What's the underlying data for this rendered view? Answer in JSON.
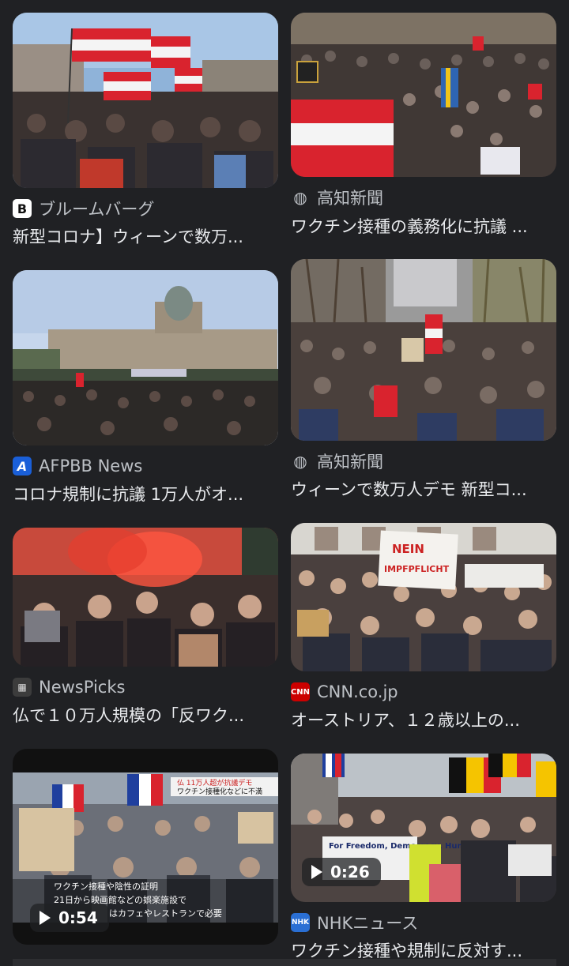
{
  "results": [
    {
      "source": "ブルームバーグ",
      "title": "新型コロナ】ウィーンで数万...",
      "source_icon": "bloomberg-icon",
      "duration": null
    },
    {
      "source": "高知新聞",
      "title": "ワクチン接種の義務化に抗議 ...",
      "source_icon": "globe-icon",
      "duration": null
    },
    {
      "source": "AFPBB News",
      "title": "コロナ規制に抗議 1万人がオ...",
      "source_icon": "afpbb-icon",
      "duration": null
    },
    {
      "source": "高知新聞",
      "title": "ウィーンで数万人デモ 新型コ...",
      "source_icon": "globe-icon",
      "duration": null
    },
    {
      "source": "NewsPicks",
      "title": "仏で１０万人規模の「反ワク...",
      "source_icon": "newspicks-icon",
      "duration": null
    },
    {
      "source": "CNN.co.jp",
      "title": "オーストリア、１２歳以上の...",
      "source_icon": "cnn-icon",
      "duration": null
    },
    {
      "source": "",
      "title": "",
      "source_icon": "",
      "duration": "0:54"
    },
    {
      "source": "NHKニュース",
      "title": "ワクチン接種や規制に反対す...",
      "source_icon": "nhk-icon",
      "duration": "0:26"
    }
  ],
  "image_text": {
    "sign_nein": "NEIN",
    "sign_impf": "IMPFPFLICHT",
    "banner_freedom": "For Freedom, Democracy, Human rights",
    "caption_vax": "ワクチン接種や陰性の証明",
    "caption_vax2": "21日から映画館などの娯楽施設で",
    "caption_vax3": "はカフェやレストランで必要",
    "caption_top": "仏 11万人超が抗議デモ",
    "caption_top2": "ワクチン接種化などに不満"
  },
  "colors": {
    "background": "#202124",
    "title_text": "#e8eaed",
    "source_text": "#bdc1c6",
    "austria_red": "#d9232e"
  }
}
